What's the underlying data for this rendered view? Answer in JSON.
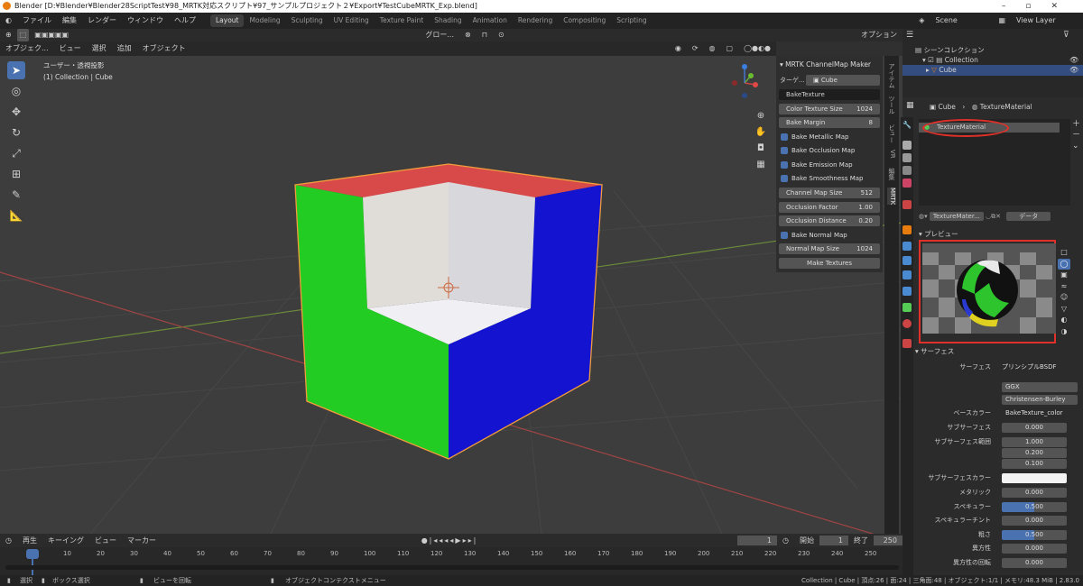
{
  "window": {
    "title": "Blender [D:¥Blender¥Blender28ScriptTest¥98_MRTK対応スクリプト¥97_サンプルプロジェクト２¥Export¥TestCubeMRTK_Exp.blend]"
  },
  "menu": [
    "ファイル",
    "編集",
    "レンダー",
    "ウィンドウ",
    "ヘルプ"
  ],
  "workspaces": [
    "Layout",
    "Modeling",
    "Sculpting",
    "UV Editing",
    "Texture Paint",
    "Shading",
    "Animation",
    "Rendering",
    "Compositing",
    "Scripting"
  ],
  "scene": {
    "scene_label": "Scene",
    "viewlayer_label": "View Layer"
  },
  "viewport_header": {
    "mode": "オブジェク...",
    "view": "ビュー",
    "select": "選択",
    "add": "追加",
    "object": "オブジェクト",
    "transform": "グロー...",
    "options": "オプション"
  },
  "viewport": {
    "view_name": "ユーザー・透視投影",
    "collection_info": "(1) Collection | Cube"
  },
  "npanel": {
    "title": "MRTK ChannelMap Maker",
    "target_label": "ターゲ...",
    "target_value": "Cube",
    "bake_texture": "BakeTexture",
    "color_texture_size_label": "Color Texture Size",
    "color_texture_size": "1024",
    "bake_margin_label": "Bake Margin",
    "bake_margin": "8",
    "bake_metallic": "Bake Metallic Map",
    "bake_occlusion": "Bake Occlusion Map",
    "bake_emission": "Bake Emission Map",
    "bake_smoothness": "Bake Smoothness Map",
    "channel_map_size_label": "Channel Map Size",
    "channel_map_size": "512",
    "occlusion_factor_label": "Occlusion Factor",
    "occlusion_factor": "1.00",
    "occlusion_distance_label": "Occlusion Distance",
    "occlusion_distance": "0.20",
    "bake_normal": "Bake Normal Map",
    "normal_map_size_label": "Normal Map Size",
    "normal_map_size": "1024",
    "make_textures": "Make Textures"
  },
  "vtabs": [
    "アイテム",
    "ツール",
    "ビュー",
    "VR",
    "編集",
    "MRTK"
  ],
  "outliner": {
    "root": "シーンコレクション",
    "collection": "Collection",
    "object": "Cube"
  },
  "properties": {
    "object": "Cube",
    "material": "TextureMaterial",
    "slot": "TextureMaterial",
    "mat_name": "TextureMater...",
    "data_label": "データ",
    "preview_label": "プレビュー",
    "surface_section": "サーフェス",
    "surface_label": "サーフェス",
    "surface_value": "プリンシプルBSDF",
    "distribution": "GGX",
    "subsurface_method": "Christensen-Burley",
    "base_color_label": "ベースカラー",
    "base_color_value": "BakeTexture_color",
    "subsurface_label": "サブサーフェス",
    "subsurface_value": "0.000",
    "subsurface_radius_label": "サブサーフェス範囲",
    "radius": [
      "1.000",
      "0.200",
      "0.100"
    ],
    "subsurface_color_label": "サブサーフェスカラー",
    "metallic_label": "メタリック",
    "metallic_value": "0.000",
    "specular_label": "スペキュラー",
    "specular_value": "0.500",
    "specular_tint_label": "スペキュラーチント",
    "specular_tint_value": "0.000",
    "roughness_label": "粗さ",
    "roughness_value": "0.500",
    "anisotropic_label": "異方性",
    "anisotropic_value": "0.000",
    "anisotropic_rot_label": "異方性の回転",
    "anisotropic_rot_value": "0.000"
  },
  "timeline": {
    "play": "再生",
    "keying": "キーイング",
    "view": "ビュー",
    "marker": "マーカー",
    "current": "1",
    "start_label": "開始",
    "start": "1",
    "end_label": "終了",
    "end": "250",
    "ticks": [
      "1",
      "10",
      "20",
      "30",
      "40",
      "50",
      "60",
      "70",
      "80",
      "90",
      "100",
      "110",
      "120",
      "130",
      "140",
      "150",
      "160",
      "170",
      "180",
      "190",
      "200",
      "210",
      "220",
      "230",
      "240",
      "250"
    ]
  },
  "status": {
    "select": "選択",
    "box_select": "ボックス選択",
    "rotate_view": "ビューを回転",
    "context_menu": "オブジェクトコンテクストメニュー",
    "info": "Collection | Cube | 頂点:26 | 面:24 | 三角面:48 | オブジェクト:1/1 | メモリ:48.3 MiB | 2.83.0"
  },
  "colors": {
    "accent": "#4a72b0",
    "highlight": "#e0302a"
  }
}
